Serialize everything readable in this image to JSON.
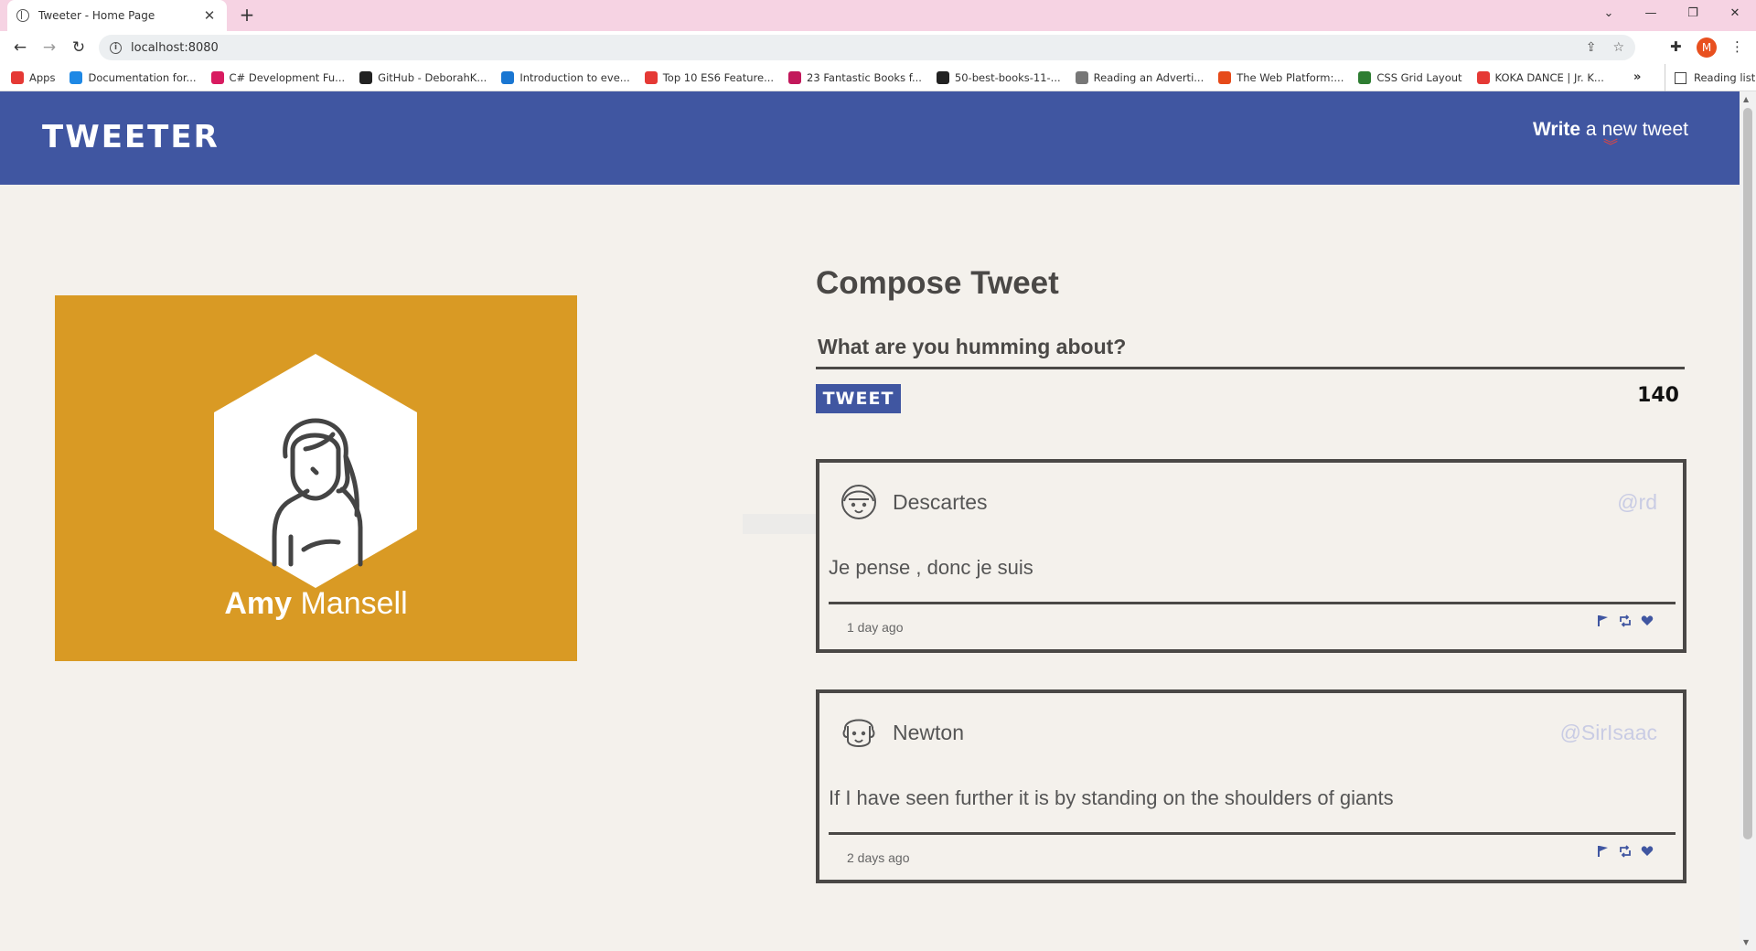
{
  "browser": {
    "tab_title": "Tweeter - Home Page",
    "tab_close": "✕",
    "new_tab": "+",
    "url": "localhost:8080",
    "profile_initial": "M",
    "bookmarks": [
      {
        "label": "Apps",
        "color": "#e53935"
      },
      {
        "label": "Documentation for...",
        "color": "#1e88e5"
      },
      {
        "label": "C# Development Fu...",
        "color": "#d81b60"
      },
      {
        "label": "GitHub - DeborahK...",
        "color": "#222222"
      },
      {
        "label": "Introduction to eve...",
        "color": "#1976d2"
      },
      {
        "label": "Top 10 ES6 Feature...",
        "color": "#e53935"
      },
      {
        "label": "23 Fantastic Books f...",
        "color": "#c2185b"
      },
      {
        "label": "50-best-books-11-...",
        "color": "#222222"
      },
      {
        "label": "Reading an Adverti...",
        "color": "#777777"
      },
      {
        "label": "The Web Platform:...",
        "color": "#e64a19"
      },
      {
        "label": "CSS Grid Layout",
        "color": "#2e7d32"
      },
      {
        "label": "KOKA DANCE | Jr. K...",
        "color": "#e53935"
      }
    ],
    "reading_list": "Reading list",
    "more": "»"
  },
  "nav": {
    "logo": "TWEETER",
    "write_bold": "Write",
    "write_rest": " a new tweet",
    "chevron": "︾"
  },
  "profile": {
    "first_name": "Amy",
    "last_name": " Mansell",
    "card_color": "#d99a24"
  },
  "compose": {
    "heading": "Compose Tweet",
    "placeholder": "What are you humming about?",
    "button": "TWEET",
    "counter": "140"
  },
  "tweets": [
    {
      "name": "Descartes",
      "handle": "@rd",
      "content": "Je pense , donc je suis",
      "time": "1 day ago"
    },
    {
      "name": "Newton",
      "handle": "@SirIsaac",
      "content": "If I have seen further it is by standing on the shoulders of giants",
      "time": "2 days ago"
    }
  ],
  "colors": {
    "nav": "#4056a1",
    "accent_red": "#e8453c",
    "text_dark": "#4a4846",
    "handle": "#c9cce4",
    "background": "#f4f1ec"
  }
}
